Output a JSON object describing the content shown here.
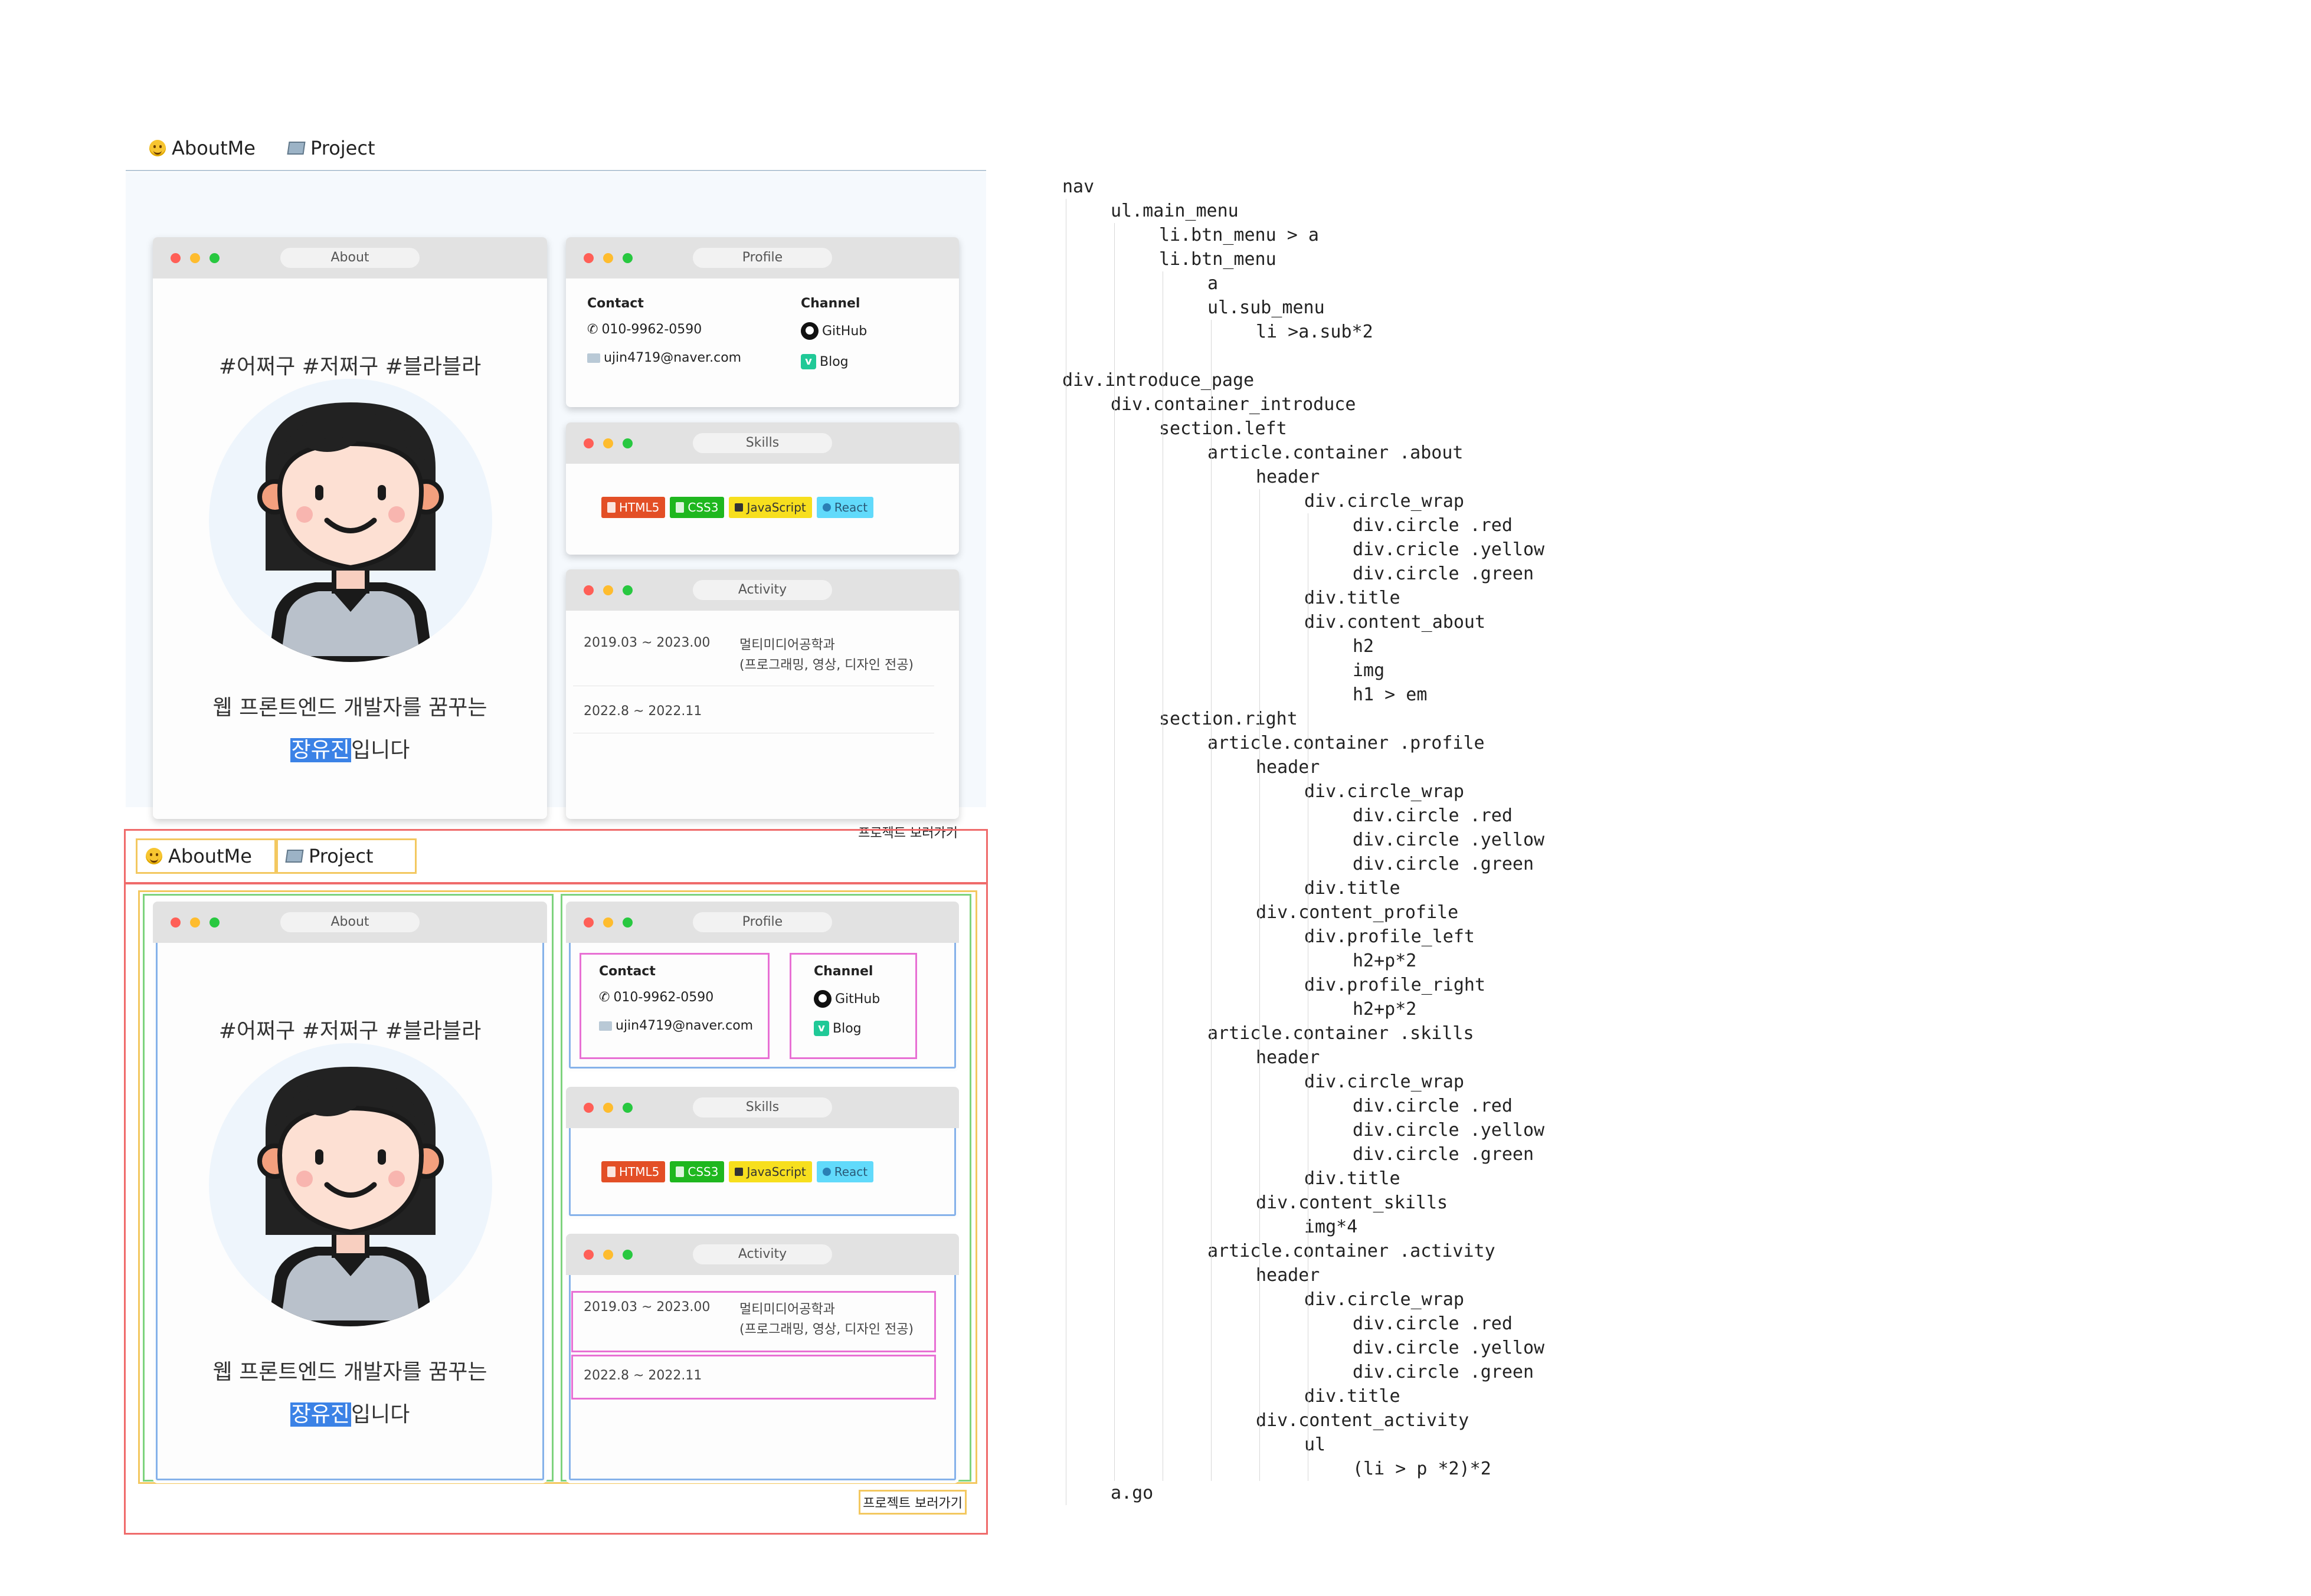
{
  "nav": {
    "items": [
      {
        "label": "AboutMe",
        "icon": "grinning-face-icon"
      },
      {
        "label": "Project",
        "icon": "map-icon"
      }
    ]
  },
  "about": {
    "title": "About",
    "h2": "#어쩌구 #저쩌구 #블라블라",
    "avatar": "girl-avatar-illustration",
    "h1_prefix": "웹 프론트엔드 개발자를 꿈꾸는",
    "h1_name": "장유진",
    "h1_suffix": "입니다"
  },
  "profile": {
    "title": "Profile",
    "contact": {
      "heading": "Contact",
      "phone": "010-9962-0590",
      "email": "ujin4719@naver.com"
    },
    "channel": {
      "heading": "Channel",
      "github": "GitHub",
      "blog": "Blog"
    }
  },
  "skills": {
    "title": "Skills",
    "badges": [
      "HTML5",
      "CSS3",
      "JavaScript",
      "React"
    ]
  },
  "activity": {
    "title": "Activity",
    "items": [
      {
        "date": "2019.03 ~ 2023.00",
        "desc1": "멀티미디어공학과",
        "desc2": "(프로그래밍, 영상, 디자인 전공)"
      },
      {
        "date": "2022.8 ~ 2022.11",
        "desc1": "",
        "desc2": ""
      }
    ]
  },
  "go_link": "프로젝트 보러가기",
  "colors": {
    "highlight": "#3b82e6",
    "dot_red": "#ff5f57",
    "dot_yellow": "#febc2e",
    "dot_green": "#28c840",
    "outline_red": "#ef6b6b",
    "outline_orange": "#f3c860",
    "outline_green": "#7ed37e",
    "outline_blue": "#86b2ea",
    "outline_pink": "#e870d4"
  },
  "code_tree": [
    {
      "indent": 0,
      "text": "nav"
    },
    {
      "indent": 1,
      "text": "ul.main_menu"
    },
    {
      "indent": 2,
      "text": "li.btn_menu > a"
    },
    {
      "indent": 2,
      "text": "li.btn_menu"
    },
    {
      "indent": 3,
      "text": "a"
    },
    {
      "indent": 3,
      "text": "ul.sub_menu"
    },
    {
      "indent": 4,
      "text": "li >a.sub*2"
    },
    {
      "indent": 0,
      "text": ""
    },
    {
      "indent": 0,
      "text": "div.introduce_page"
    },
    {
      "indent": 1,
      "text": "div.container_introduce"
    },
    {
      "indent": 2,
      "text": "section.left"
    },
    {
      "indent": 3,
      "text": "article.container .about"
    },
    {
      "indent": 4,
      "text": "header"
    },
    {
      "indent": 5,
      "text": "div.circle_wrap"
    },
    {
      "indent": 6,
      "text": "div.circle .red"
    },
    {
      "indent": 6,
      "text": "div.cricle .yellow"
    },
    {
      "indent": 6,
      "text": "div.circle .green"
    },
    {
      "indent": 5,
      "text": "div.title"
    },
    {
      "indent": 5,
      "text": "div.content_about"
    },
    {
      "indent": 6,
      "text": "h2"
    },
    {
      "indent": 6,
      "text": "img"
    },
    {
      "indent": 6,
      "text": "h1 > em"
    },
    {
      "indent": 2,
      "text": "section.right"
    },
    {
      "indent": 3,
      "text": "article.container .profile"
    },
    {
      "indent": 4,
      "text": "header"
    },
    {
      "indent": 5,
      "text": "div.circle_wrap"
    },
    {
      "indent": 6,
      "text": "div.circle .red"
    },
    {
      "indent": 6,
      "text": "div.circle .yellow"
    },
    {
      "indent": 6,
      "text": "div.circle .green"
    },
    {
      "indent": 5,
      "text": "div.title"
    },
    {
      "indent": 4,
      "text": "div.content_profile"
    },
    {
      "indent": 5,
      "text": "div.profile_left"
    },
    {
      "indent": 6,
      "text": "h2+p*2"
    },
    {
      "indent": 5,
      "text": "div.profile_right"
    },
    {
      "indent": 6,
      "text": "h2+p*2"
    },
    {
      "indent": 3,
      "text": "article.container .skills"
    },
    {
      "indent": 4,
      "text": "header"
    },
    {
      "indent": 5,
      "text": "div.circle_wrap"
    },
    {
      "indent": 6,
      "text": "div.circle .red"
    },
    {
      "indent": 6,
      "text": "div.circle .yellow"
    },
    {
      "indent": 6,
      "text": "div.circle .green"
    },
    {
      "indent": 5,
      "text": "div.title"
    },
    {
      "indent": 4,
      "text": "div.content_skills"
    },
    {
      "indent": 5,
      "text": "img*4"
    },
    {
      "indent": 3,
      "text": "article.container .activity"
    },
    {
      "indent": 4,
      "text": "header"
    },
    {
      "indent": 5,
      "text": "div.circle_wrap"
    },
    {
      "indent": 6,
      "text": "div.circle .red"
    },
    {
      "indent": 6,
      "text": "div.circle .yellow"
    },
    {
      "indent": 6,
      "text": "div.circle .green"
    },
    {
      "indent": 5,
      "text": "div.title"
    },
    {
      "indent": 4,
      "text": "div.content_activity"
    },
    {
      "indent": 5,
      "text": "ul"
    },
    {
      "indent": 6,
      "text": "(li > p *2)*2"
    },
    {
      "indent": 1,
      "text": "a.go"
    }
  ]
}
